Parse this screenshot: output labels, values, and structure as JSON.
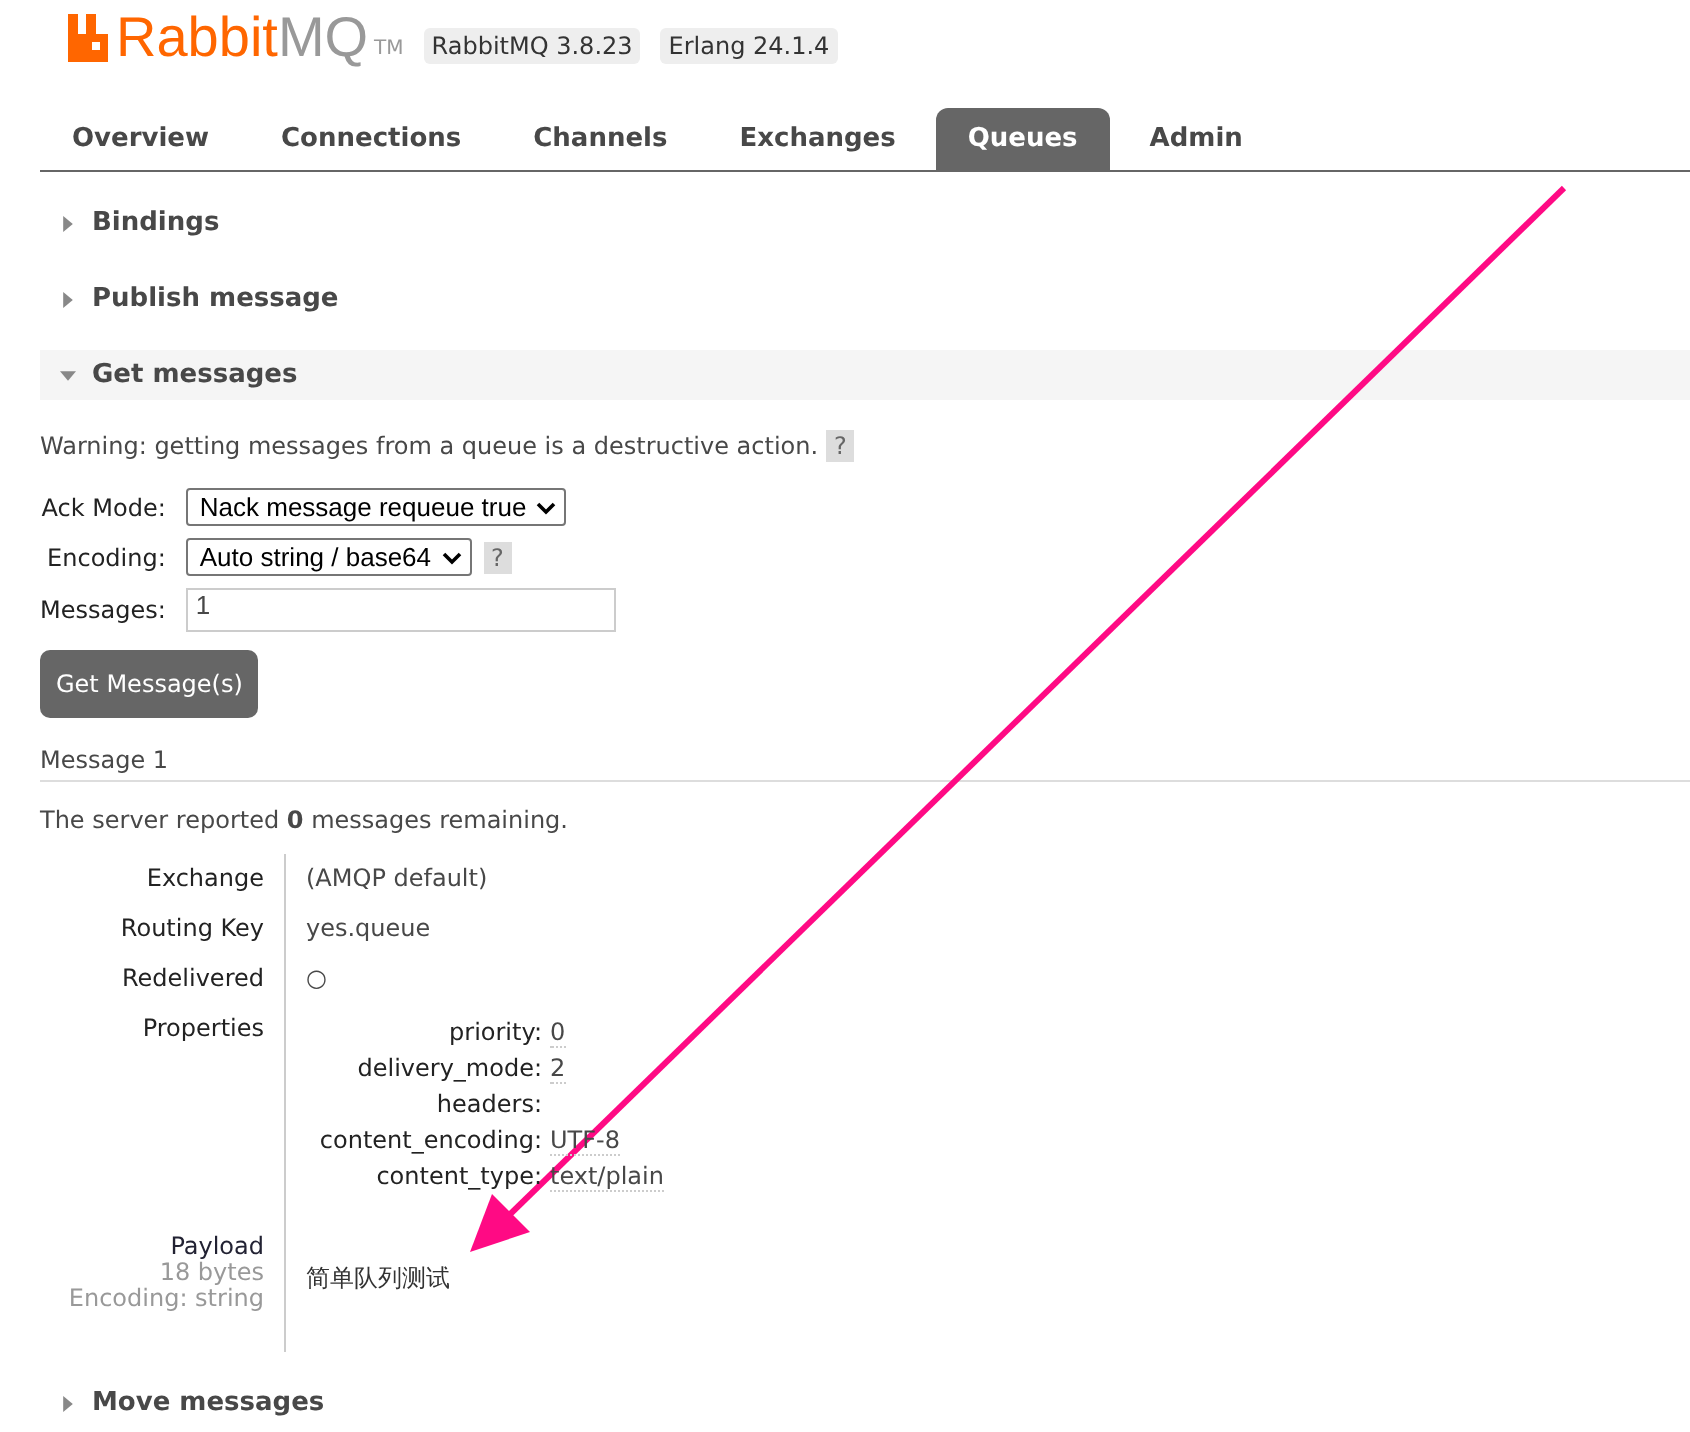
{
  "header": {
    "logo": {
      "primary": "Rabbit",
      "secondary": "MQ",
      "trademark": "TM"
    },
    "badges": [
      "RabbitMQ 3.8.23",
      "Erlang 24.1.4"
    ]
  },
  "tabs": [
    {
      "label": "Overview",
      "selected": false
    },
    {
      "label": "Connections",
      "selected": false
    },
    {
      "label": "Channels",
      "selected": false
    },
    {
      "label": "Exchanges",
      "selected": false
    },
    {
      "label": "Queues",
      "selected": true
    },
    {
      "label": "Admin",
      "selected": false
    }
  ],
  "sections": [
    {
      "title": "Bindings",
      "expanded": false
    },
    {
      "title": "Publish message",
      "expanded": false
    },
    {
      "title": "Get messages",
      "expanded": true
    },
    {
      "title": "Move messages",
      "expanded": false
    }
  ],
  "get_messages": {
    "warning": "Warning: getting messages from a queue is a destructive action.",
    "warning_help": "?",
    "form": [
      {
        "kind": "select",
        "label": "Ack Mode:",
        "value": "Nack message requeue true"
      },
      {
        "kind": "select",
        "label": "Encoding:",
        "value": "Auto string / base64",
        "help": "?"
      },
      {
        "kind": "input",
        "label": "Messages:",
        "value": "1"
      }
    ],
    "button": "Get Message(s)",
    "message": {
      "heading": "Message 1",
      "remaining": "The server reported **0** messages remaining.",
      "fields": [
        {
          "label": "Exchange",
          "value": "(AMQP default)"
        },
        {
          "label": "Routing Key",
          "value": "yes.queue"
        },
        {
          "label": "Redelivered",
          "value": "○"
        }
      ],
      "properties_label": "Properties",
      "properties": [
        {
          "key": "priority:",
          "value": "0"
        },
        {
          "key": "delivery_mode:",
          "value": "2"
        },
        {
          "key": "headers:"
        },
        {
          "key": "content_encoding:",
          "value": "UTF-8"
        },
        {
          "key": "content_type:",
          "value": "text/plain"
        }
      ],
      "payload": {
        "label": "Payload",
        "size": "18 bytes",
        "encoding": "Encoding: string",
        "value": "简单队列测试"
      }
    }
  }
}
